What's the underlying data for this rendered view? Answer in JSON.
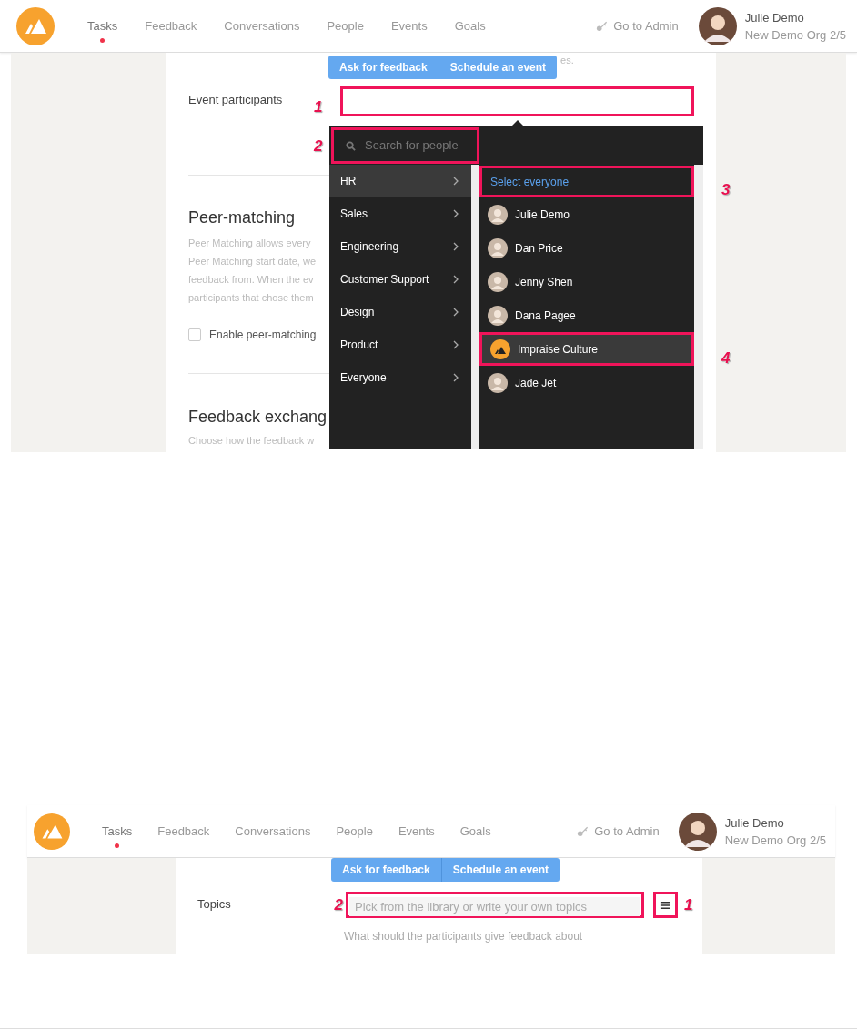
{
  "screen_1": {
    "header": {
      "tabs": [
        {
          "label": "Tasks",
          "selected": true
        },
        {
          "label": "Feedback",
          "selected": false
        },
        {
          "label": "Conversations",
          "selected": false
        },
        {
          "label": "People",
          "selected": false
        },
        {
          "label": "Events",
          "selected": false
        },
        {
          "label": "Goals",
          "selected": false
        }
      ],
      "admin_link": "Go to Admin",
      "user": {
        "name": "Julie Demo",
        "org": "New Demo Org 2/5"
      }
    },
    "action_buttons": [
      "Ask for feedback",
      "Schedule an event"
    ],
    "faded_text": "es.",
    "participants": {
      "label": "Event participants",
      "callout": "1",
      "highlighted": true
    },
    "picker": {
      "search": {
        "placeholder": "Search for people",
        "callout": "2",
        "highlighted": true
      },
      "groups": [
        {
          "label": "HR",
          "selected": true
        },
        {
          "label": "Sales",
          "selected": false
        },
        {
          "label": "Engineering",
          "selected": false
        },
        {
          "label": "Customer Support",
          "selected": false
        },
        {
          "label": "Design",
          "selected": false
        },
        {
          "label": "Product",
          "selected": false
        },
        {
          "label": "Everyone",
          "selected": false
        }
      ],
      "select_all": {
        "label": "Select everyone",
        "callout": "3",
        "highlighted": true
      },
      "people": [
        {
          "name": "Julie Demo",
          "kind": "person",
          "selected": false
        },
        {
          "name": "Dan Price",
          "kind": "person",
          "selected": false
        },
        {
          "name": "Jenny Shen",
          "kind": "person",
          "selected": false
        },
        {
          "name": "Dana Pagee",
          "kind": "person",
          "selected": false
        },
        {
          "name": "Impraise Culture",
          "kind": "org",
          "selected": true,
          "callout": "4"
        },
        {
          "name": "Jade Jet",
          "kind": "person",
          "selected": false
        }
      ]
    },
    "peer_matching": {
      "heading": "Peer-matching",
      "lines": [
        "Peer Matching allows every",
        "Peer Matching start date, we",
        "feedback from. When the ev",
        "participants that chose them"
      ],
      "checkbox": {
        "label": "Enable peer-matching",
        "checked": false
      }
    },
    "feedback_exchange": {
      "heading": "Feedback exchang",
      "description": "Choose how the feedback w"
    }
  },
  "screen_2": {
    "header": {
      "tabs": [
        {
          "label": "Tasks",
          "selected": true
        },
        {
          "label": "Feedback",
          "selected": false
        },
        {
          "label": "Conversations",
          "selected": false
        },
        {
          "label": "People",
          "selected": false
        },
        {
          "label": "Events",
          "selected": false
        },
        {
          "label": "Goals",
          "selected": false
        }
      ],
      "admin_link": "Go to Admin",
      "user": {
        "name": "Julie Demo",
        "org": "New Demo Org 2/5"
      }
    },
    "action_buttons": [
      "Ask for feedback",
      "Schedule an event"
    ],
    "topics": {
      "label": "Topics",
      "placeholder": "Pick from the library or write your own topics",
      "callout": "2",
      "highlighted": true,
      "menu_callout": "1",
      "menu_highlighted": true,
      "hint": "What should the participants give feedback about"
    }
  }
}
